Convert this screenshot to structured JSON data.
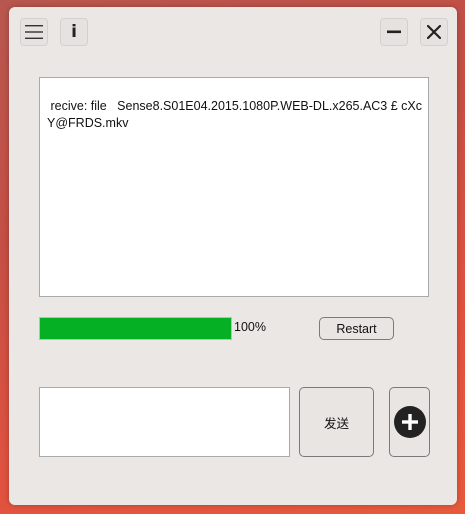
{
  "toolbar": {
    "menu_icon": "menu-icon",
    "info_icon": "info-icon",
    "info_glyph": "i",
    "minimize_icon": "minimize-icon",
    "close_icon": "close-icon"
  },
  "log": {
    "text": " recive: file   Sense8.S01E04.2015.1080P.WEB-DL.x265.AC3 £ cXcY@FRDS.mkv"
  },
  "progress": {
    "value": 1.0,
    "label": "100%",
    "color": "#06b025"
  },
  "restart_button": {
    "label": "Restart"
  },
  "message_input": {
    "value": ""
  },
  "send_button": {
    "label": "发送"
  },
  "add_button": {
    "icon": "plus-circle-icon"
  }
}
